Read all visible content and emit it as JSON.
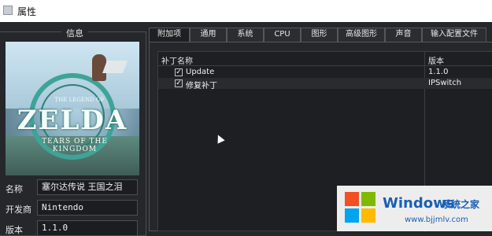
{
  "window": {
    "title": "属性"
  },
  "info": {
    "heading": "信息",
    "cover": {
      "small": "THE LEGEND OF",
      "main": "ZELDA",
      "sub": "TEARS OF THE KINGDOM"
    },
    "fields": [
      {
        "label": "名称",
        "value": "塞尔达传说 王国之泪"
      },
      {
        "label": "开发商",
        "value": "Nintendo"
      },
      {
        "label": "版本",
        "value": "1.1.0"
      }
    ]
  },
  "tabs": [
    "附加项",
    "通用",
    "系统",
    "CPU",
    "图形",
    "高级图形",
    "声音",
    "输入配置文件"
  ],
  "active_tab": "附加项",
  "patches": {
    "columns": {
      "name": "补丁名称",
      "version": "版本"
    },
    "rows": [
      {
        "checked": true,
        "name": "Update",
        "version": "1.1.0"
      },
      {
        "checked": true,
        "name": "修复补丁",
        "version": "IPSwitch"
      }
    ]
  },
  "watermark": {
    "brand": "Windows",
    "brand_cn": "系统之家",
    "url": "www.bjjmlv.com",
    "colors": [
      "#f25022",
      "#7fba00",
      "#00a4ef",
      "#ffb900"
    ]
  }
}
